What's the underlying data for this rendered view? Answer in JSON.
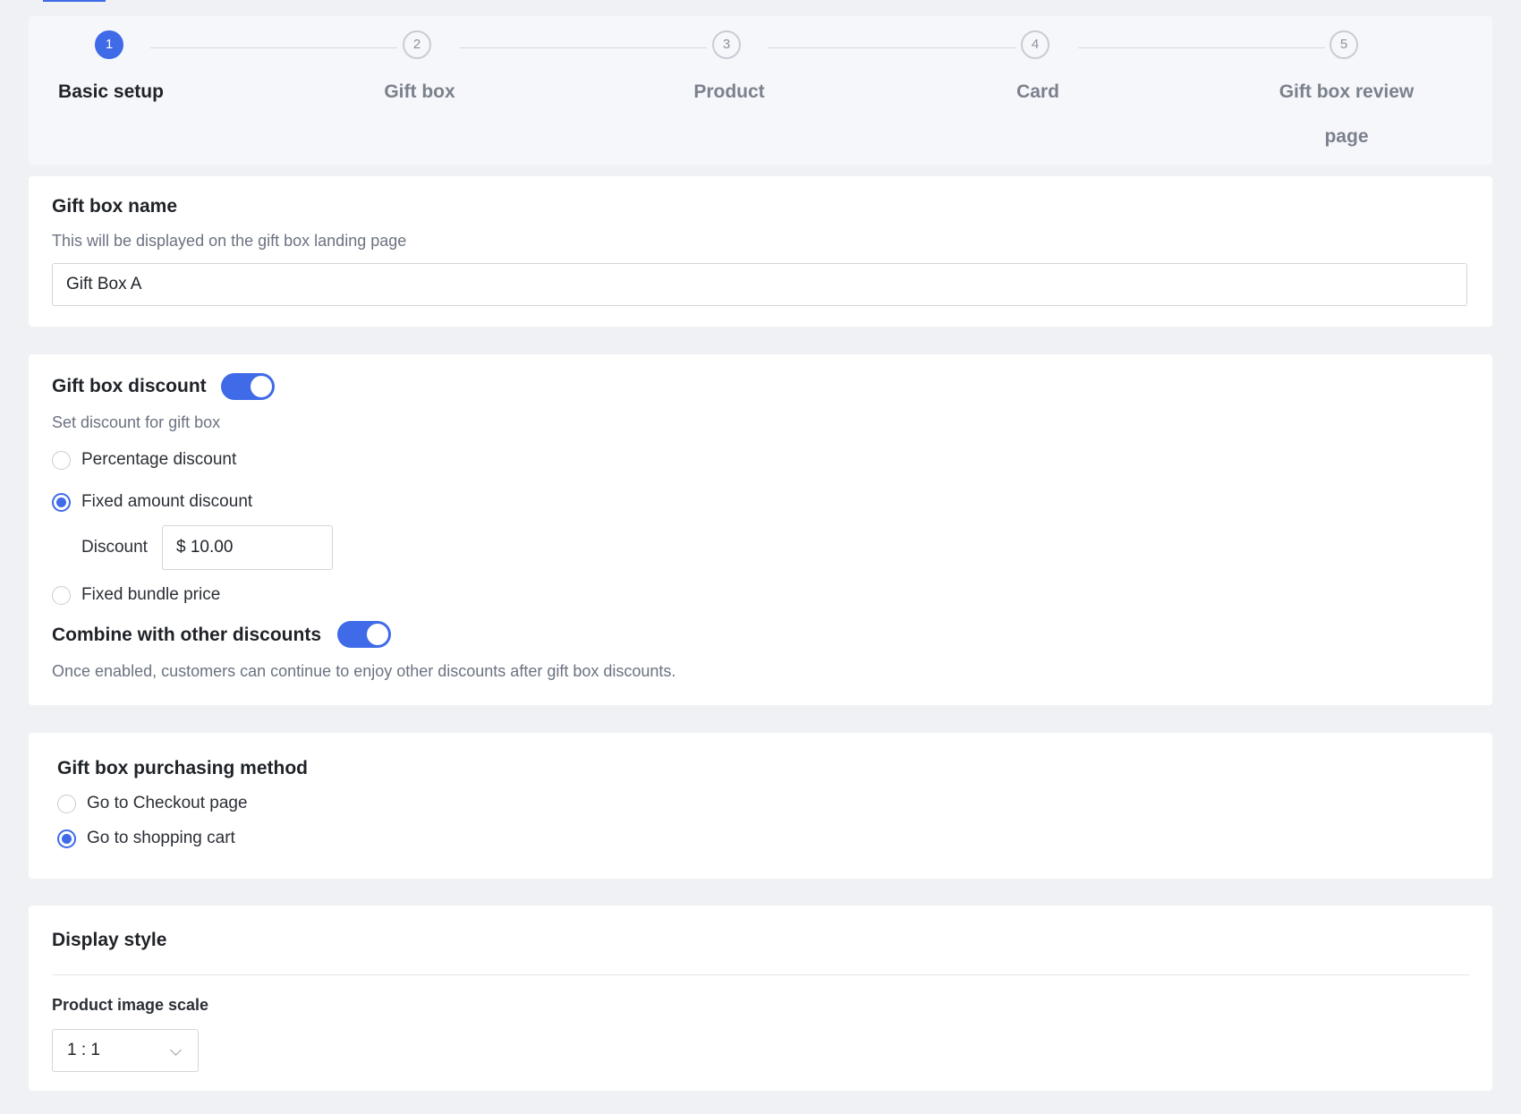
{
  "stepper": {
    "steps": [
      {
        "number": "1",
        "label": "Basic setup",
        "active": true
      },
      {
        "number": "2",
        "label": "Gift box",
        "active": false
      },
      {
        "number": "3",
        "label": "Product",
        "active": false
      },
      {
        "number": "4",
        "label": "Card",
        "active": false
      },
      {
        "number": "5",
        "label_line1": "Gift box review",
        "label_line2": "page",
        "active": false
      }
    ]
  },
  "gift_box_name": {
    "title": "Gift box name",
    "description": "This will be displayed on the gift box landing page",
    "value": "Gift Box A"
  },
  "gift_box_discount": {
    "title": "Gift box discount",
    "enabled": true,
    "description": "Set discount for gift box",
    "options": {
      "percentage": "Percentage discount",
      "fixed_amount": "Fixed amount discount",
      "fixed_bundle": "Fixed bundle price"
    },
    "selected": "Fixed amount discount",
    "discount_label": "Discount",
    "discount_value": "$ 10.00",
    "combine_title": "Combine with other discounts",
    "combine_enabled": true,
    "combine_description": "Once enabled, customers can continue to enjoy other discounts after gift box discounts."
  },
  "purchasing_method": {
    "title": "Gift box purchasing method",
    "options": {
      "checkout": "Go to Checkout page",
      "cart": "Go to shopping cart"
    },
    "selected": "Go to shopping cart"
  },
  "display_style": {
    "title": "Display style",
    "image_scale_label": "Product image scale",
    "image_scale_value": "1 : 1"
  },
  "colors": {
    "accent": "#3f6ae8",
    "background": "#f0f1f4"
  }
}
